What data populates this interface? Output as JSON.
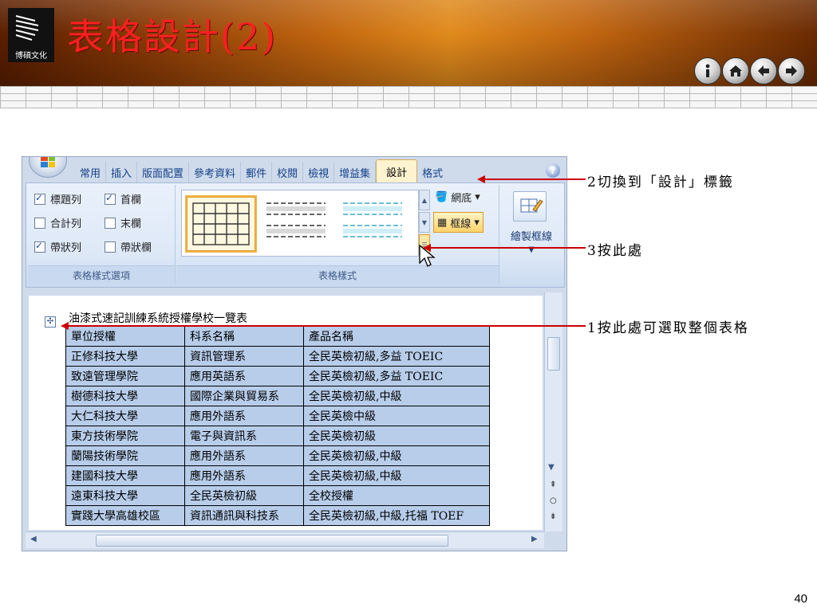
{
  "header": {
    "logo_text": "博碩文化",
    "title": "表格設計(2)",
    "nav": [
      "info",
      "home",
      "back",
      "forward"
    ]
  },
  "ribbon": {
    "tabs": [
      "常用",
      "插入",
      "版面配置",
      "參考資料",
      "郵件",
      "校閱",
      "檢視",
      "增益集",
      "設計",
      "格式"
    ],
    "active_tab": "設計",
    "style_options": {
      "items": [
        {
          "label": "標題列",
          "checked": true
        },
        {
          "label": "首欄",
          "checked": true
        },
        {
          "label": "合計列",
          "checked": false
        },
        {
          "label": "末欄",
          "checked": false
        },
        {
          "label": "帶狀列",
          "checked": true
        },
        {
          "label": "帶狀欄",
          "checked": false
        }
      ],
      "group_label": "表格樣式選項"
    },
    "styles": {
      "group_label": "表格樣式",
      "shading_label": "網底",
      "borders_label": "框線"
    },
    "draw": {
      "label": "繪製框線"
    }
  },
  "document": {
    "title": "油漆式速記訓練系統授權學校一覽表",
    "rows": [
      [
        "單位授權",
        "科系名稱",
        "產品名稱"
      ],
      [
        "正修科技大學",
        "資訊管理系",
        "全民英檢初級,多益 TOEIC"
      ],
      [
        "致遠管理學院",
        "應用英語系",
        "全民英檢初級,多益 TOEIC"
      ],
      [
        "樹德科技大學",
        "國際企業與貿易系",
        "全民英檢初級,中級"
      ],
      [
        "大仁科技大學",
        "應用外語系",
        "全民英檢中級"
      ],
      [
        "東方技術學院",
        "電子與資訊系",
        "全民英檢初級"
      ],
      [
        "蘭陽技術學院",
        "應用外語系",
        "全民英檢初級,中級"
      ],
      [
        "建國科技大學",
        "應用外語系",
        "全民英檢初級,中級"
      ],
      [
        "遠東科技大學",
        "全民英檢初級",
        "全校授權"
      ],
      [
        "實踐大學高雄校區",
        "資訊通訊與科技系",
        "全民英檢初級,中級,托福 TOEF"
      ]
    ]
  },
  "callouts": {
    "step2": "2切換到「設計」標籤",
    "step3": "3按此處",
    "step1": "1按此處可選取整個表格"
  },
  "page_number": "40",
  "colors": {
    "title_red": "#ff1f1f",
    "table_fill": "#b7cdea",
    "arrow_red": "#cc0000"
  }
}
